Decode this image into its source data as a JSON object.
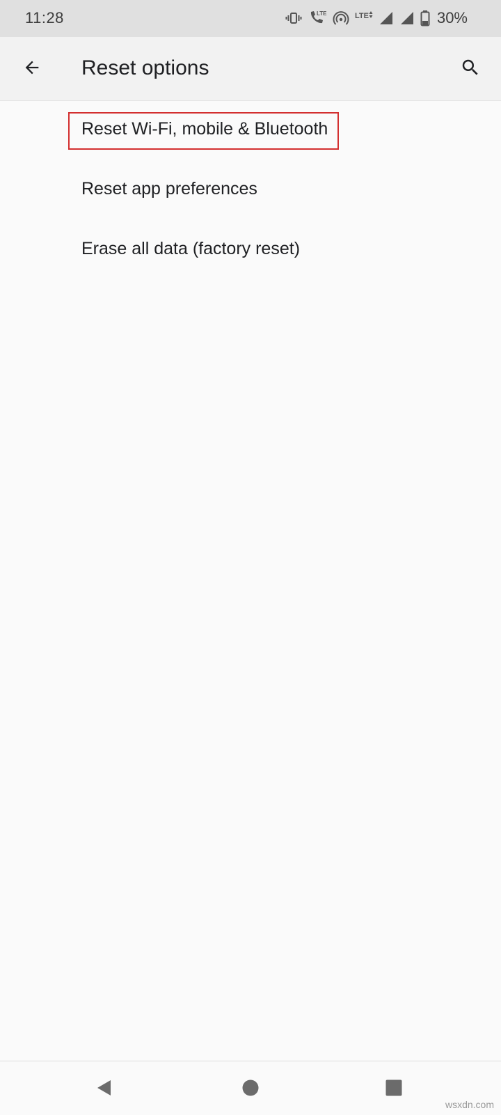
{
  "status_bar": {
    "time": "11:28",
    "icons": [
      "vibrate-icon",
      "volte-call-icon",
      "hotspot-icon",
      "lte-data-icon",
      "signal-icon",
      "signal-icon",
      "battery-icon"
    ],
    "lte_label": "LTE",
    "battery_percent": "30%"
  },
  "app_bar": {
    "title": "Reset options",
    "back_icon": "arrow-back-icon",
    "search_icon": "search-icon"
  },
  "options": [
    {
      "label": "Reset Wi-Fi, mobile & Bluetooth",
      "highlighted": true
    },
    {
      "label": "Reset app preferences",
      "highlighted": false
    },
    {
      "label": "Erase all data (factory reset)",
      "highlighted": false
    }
  ],
  "highlight_color": "#d32f2f",
  "nav_bar": {
    "buttons": [
      "nav-back-icon",
      "nav-home-icon",
      "nav-recents-icon"
    ]
  },
  "watermark": "wsxdn.com"
}
